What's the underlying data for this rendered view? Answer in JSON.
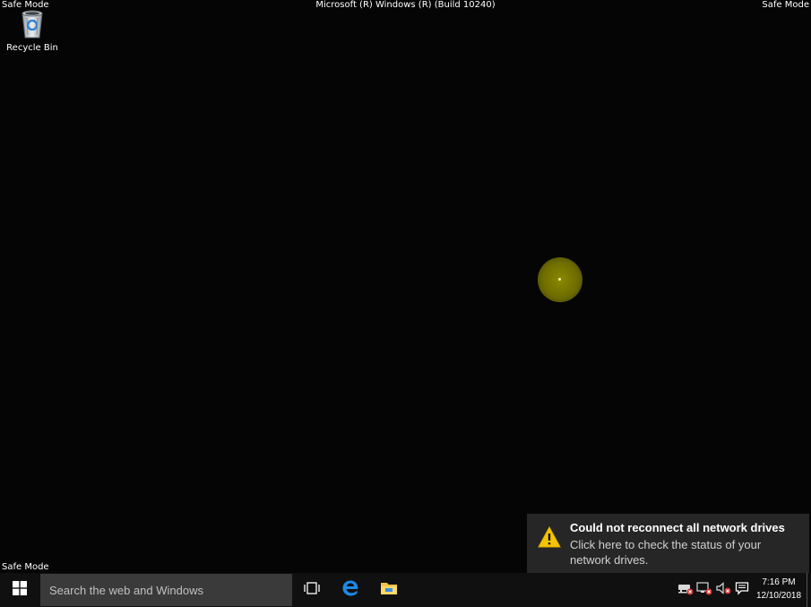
{
  "desktop": {
    "safe_mode_top_left": "Safe Mode",
    "safe_mode_top_right": "Safe Mode",
    "safe_mode_bottom_left": "Safe Mode",
    "build_text": "Microsoft (R) Windows (R) (Build 10240)",
    "background_color": "#050505",
    "icons": [
      {
        "label": "Recycle Bin",
        "icon": "recycle-bin-icon"
      }
    ],
    "cursor_highlight_color": "#6e6d00"
  },
  "notification": {
    "icon": "warning-icon",
    "title": "Could not reconnect all network drives",
    "body": "Click here to check the status of your network drives."
  },
  "taskbar": {
    "start_icon": "windows-logo-icon",
    "search_placeholder": "Search the web and Windows",
    "pinned": [
      {
        "name": "Task View",
        "icon": "task-view-icon"
      },
      {
        "name": "Microsoft Edge",
        "icon": "edge-icon"
      },
      {
        "name": "File Explorer",
        "icon": "folder-icon"
      }
    ],
    "tray": [
      {
        "name": "Network drive error",
        "icon": "network-drive-error-icon"
      },
      {
        "name": "Network disconnected",
        "icon": "network-error-icon"
      },
      {
        "name": "Volume muted",
        "icon": "volume-muted-icon"
      },
      {
        "name": "Action Center",
        "icon": "action-center-icon"
      }
    ],
    "clock": {
      "time": "7:16 PM",
      "date": "12/10/2018"
    }
  }
}
